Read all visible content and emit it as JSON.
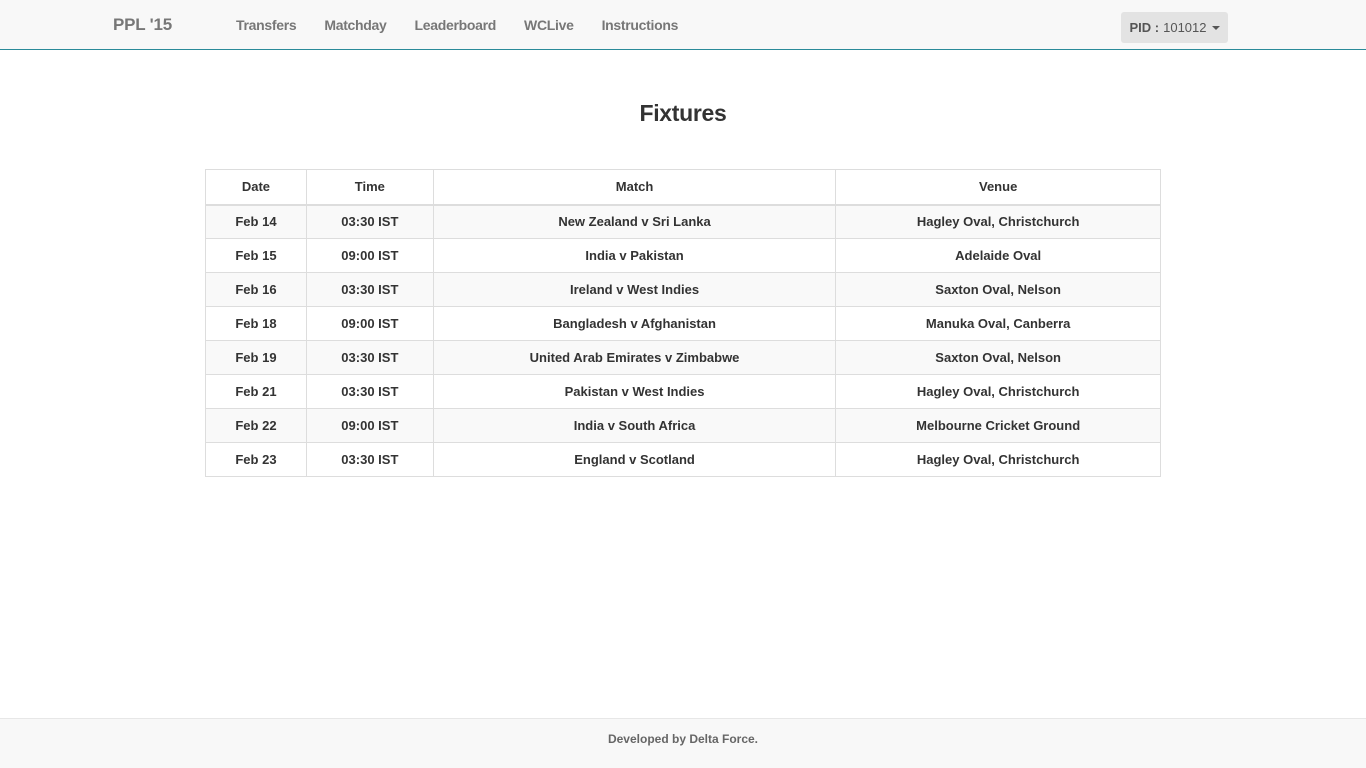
{
  "navbar": {
    "brand": "PPL '15",
    "links": [
      "Transfers",
      "Matchday",
      "Leaderboard",
      "WCLive",
      "Instructions"
    ],
    "pid_label": "PID :",
    "pid_value": "101012"
  },
  "main": {
    "title": "Fixtures",
    "table": {
      "headers": [
        "Date",
        "Time",
        "Match",
        "Venue"
      ],
      "rows": [
        [
          "Feb 14",
          "03:30 IST",
          "New Zealand v Sri Lanka",
          "Hagley Oval, Christchurch"
        ],
        [
          "Feb 15",
          "09:00 IST",
          "India v Pakistan",
          "Adelaide Oval"
        ],
        [
          "Feb 16",
          "03:30 IST",
          "Ireland v West Indies",
          "Saxton Oval, Nelson"
        ],
        [
          "Feb 18",
          "09:00 IST",
          "Bangladesh v Afghanistan",
          "Manuka Oval, Canberra"
        ],
        [
          "Feb 19",
          "03:30 IST",
          "United Arab Emirates v Zimbabwe",
          "Saxton Oval, Nelson"
        ],
        [
          "Feb 21",
          "03:30 IST",
          "Pakistan v West Indies",
          "Hagley Oval, Christchurch"
        ],
        [
          "Feb 22",
          "09:00 IST",
          "India v South Africa",
          "Melbourne Cricket Ground"
        ],
        [
          "Feb 23",
          "03:30 IST",
          "England v Scotland",
          "Hagley Oval, Christchurch"
        ]
      ]
    }
  },
  "footer": {
    "text": "Developed by Delta Force."
  },
  "colors": {
    "navbar_bg": "#f8f8f8",
    "navbar_border": "#2a8a99",
    "stripe": "#f9f9f9",
    "border": "#dddddd"
  }
}
